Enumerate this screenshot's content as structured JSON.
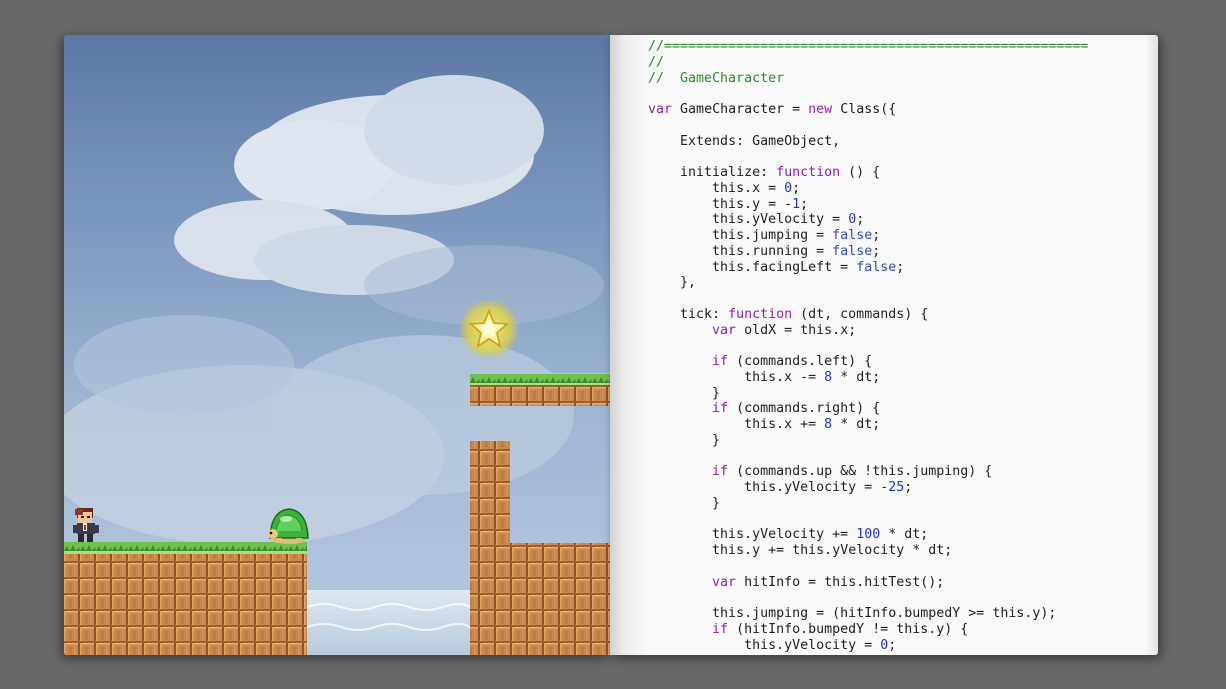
{
  "game": {
    "scene": "platformer",
    "sprites": {
      "player": "player-character-sprite",
      "enemy": "turtle-enemy-sprite",
      "collectible": "star-icon"
    },
    "colors": {
      "sky_top": "#5d78a4",
      "sky_bottom": "#b9cbe0",
      "grass": "#6cc34c",
      "brick": "#c9884a",
      "water": "#d5e3ee",
      "star": "#f2e640"
    }
  },
  "code": {
    "language": "javascript",
    "lines": [
      "//=====================================================",
      "//",
      "//  GameCharacter",
      "",
      "var GameCharacter = new Class({",
      "",
      "    Extends: GameObject,",
      "",
      "    initialize: function () {",
      "        this.x = 0;",
      "        this.y = -1;",
      "        this.yVelocity = 0;",
      "        this.jumping = false;",
      "        this.running = false;",
      "        this.facingLeft = false;",
      "    },",
      "",
      "    tick: function (dt, commands) {",
      "        var oldX = this.x;",
      "",
      "        if (commands.left) {",
      "            this.x -= 8 * dt;",
      "        }",
      "        if (commands.right) {",
      "            this.x += 8 * dt;",
      "        }",
      "",
      "        if (commands.up && !this.jumping) {",
      "            this.yVelocity = -25;",
      "        }",
      "",
      "        this.yVelocity += 100 * dt;",
      "        this.y += this.yVelocity * dt;",
      "",
      "        var hitInfo = this.hitTest();",
      "",
      "        this.jumping = (hitInfo.bumpedY >= this.y);",
      "        if (hitInfo.bumpedY != this.y) {",
      "            this.yVelocity = 0;"
    ]
  }
}
